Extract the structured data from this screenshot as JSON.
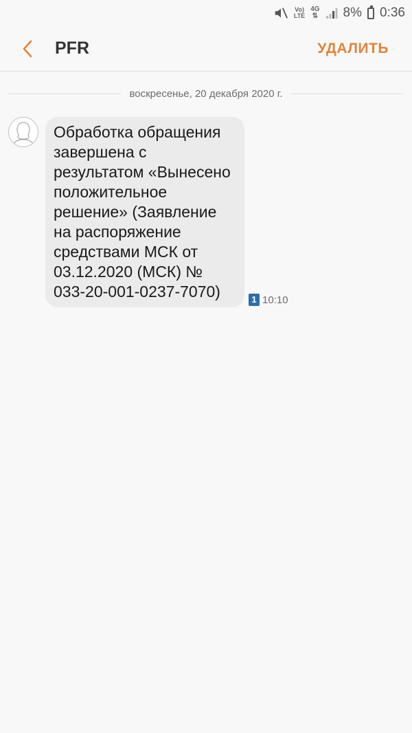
{
  "status_bar": {
    "volte_top": "Vo)",
    "volte_bottom": "LTE",
    "network": "4G",
    "battery_percent": "8%",
    "time": "0:36",
    "icons": [
      "mute-icon",
      "volte-icon",
      "network-4g-icon",
      "signal-icon",
      "battery-icon"
    ]
  },
  "app_bar": {
    "title": "PFR",
    "delete_label": "УДАЛИТЬ",
    "back_icon": "chevron-left-icon"
  },
  "conversation": {
    "date_label": "воскресенье, 20 декабря 2020 г.",
    "messages": [
      {
        "text": "Обработка обращения завершена с результатом «Вынесено положительное решение» (Заявление на распоряжение средствами МСК от 03.12.2020 (МСК) № 033-20-001-0237-7070)",
        "sim": "1",
        "time": "10:10",
        "avatar_icon": "person-avatar-icon"
      }
    ]
  },
  "colors": {
    "accent": "#e0843a",
    "bubble": "#ebebeb",
    "background": "#f8f8f8",
    "sim_badge": "#2d6ea5"
  }
}
